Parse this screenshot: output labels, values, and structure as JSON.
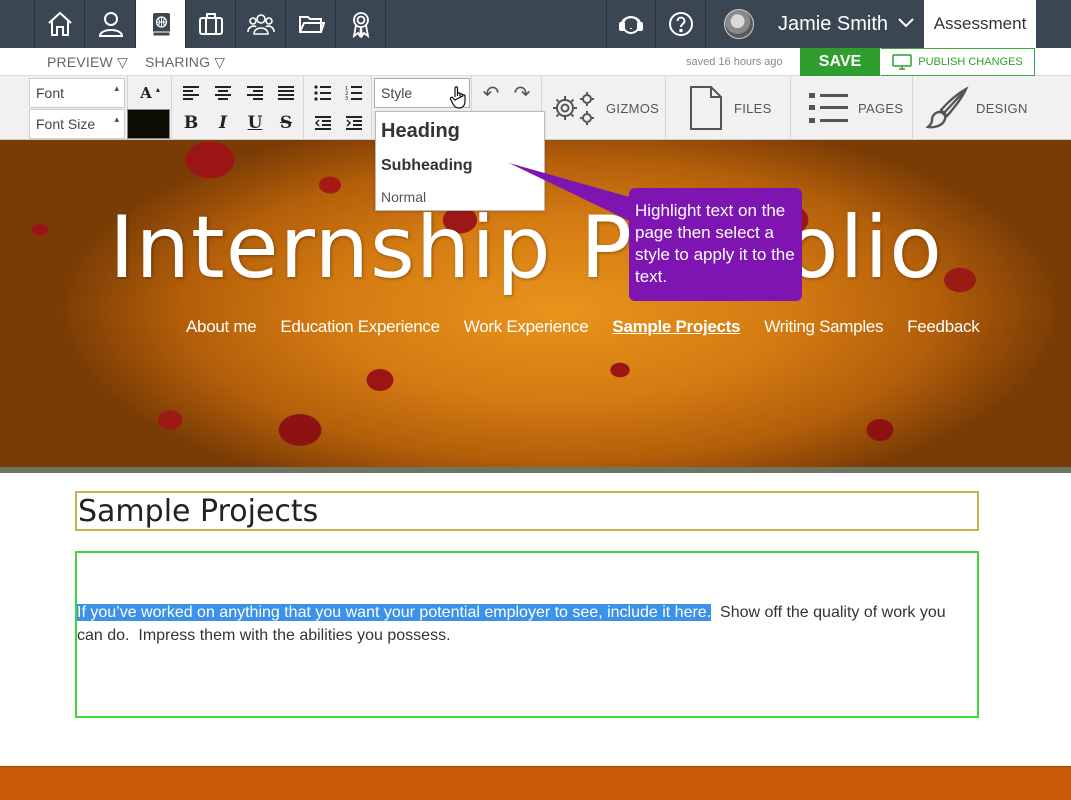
{
  "nav": {
    "icons": [
      "home-icon",
      "profile-icon",
      "portfolio-globe-book-icon",
      "briefcase-icon",
      "groups-icon",
      "folder-icon",
      "award-icon",
      "support-headset-icon",
      "help-icon"
    ],
    "user_name": "Jamie Smith",
    "assessment_label": "Assessment"
  },
  "subbar": {
    "preview_label": "PREVIEW",
    "sharing_label": "SHARING",
    "saved_text": "saved 16 hours ago",
    "save_label": "SAVE",
    "publish_label": "PUBLISH CHANGES"
  },
  "toolbar": {
    "font_placeholder": "Font",
    "font_size_placeholder": "Font Size",
    "style_label": "Style",
    "bold": "B",
    "italic": "I",
    "underline": "U",
    "strike": "S",
    "gizmos_label": "GIZMOS",
    "files_label": "FILES",
    "pages_label": "PAGES",
    "design_label": "DESIGN"
  },
  "style_dropdown": {
    "heading": "Heading",
    "subheading": "Subheading",
    "normal": "Normal"
  },
  "callout": {
    "text": "Highlight text on the page then select a style to apply it to the text."
  },
  "hero": {
    "title": "Internship Portfolio",
    "nav": [
      "About me",
      "Education Experience",
      "Work Experience",
      "Sample Projects",
      "Writing Samples",
      "Feedback"
    ],
    "active_nav": "Sample Projects"
  },
  "content": {
    "section_title": "Sample Projects",
    "highlighted_text": "If you’ve worked on anything that you want your potential employer to see, include it here.",
    "rest_text": "  Show off the quality of work you can do.  Impress them with the abilities you possess."
  },
  "colors": {
    "nav_bg": "#3a4652",
    "save_green": "#2f9e2f",
    "callout_purple": "#7e14b2",
    "highlight_blue": "#3b92e8",
    "title_border": "#c8b44a",
    "body_border": "#3ed63e",
    "footer_orange": "#c85a06"
  }
}
